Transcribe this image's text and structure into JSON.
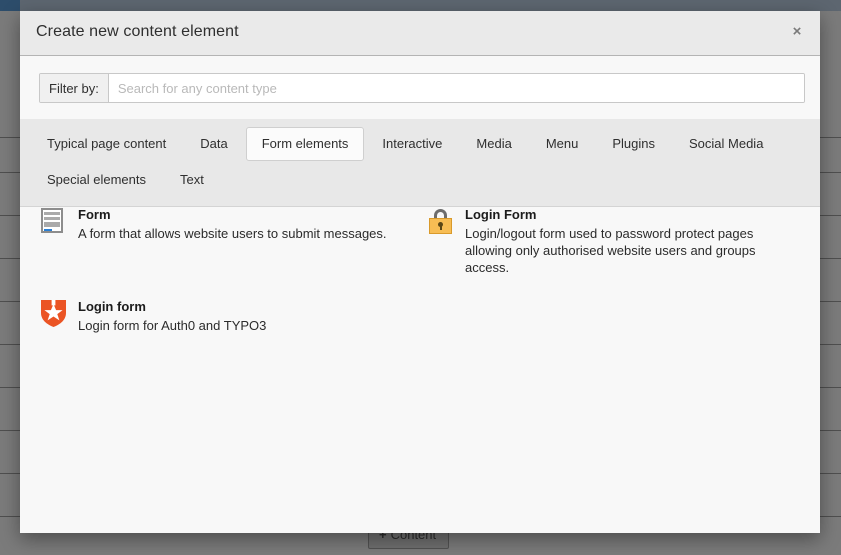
{
  "backdrop": {
    "content_button_label": "Content",
    "content_button_plus": "+",
    "row_positions": [
      137,
      172,
      215,
      258,
      301,
      344,
      387,
      430,
      473,
      516
    ]
  },
  "modal": {
    "title": "Create new content element",
    "close_label": "×",
    "close_icon": "close-icon"
  },
  "filter": {
    "label": "Filter by:",
    "placeholder": "Search for any content type",
    "value": ""
  },
  "tabs": {
    "rows": [
      [
        {
          "label": "Typical page content",
          "active": false
        },
        {
          "label": "Data",
          "active": false
        },
        {
          "label": "Form elements",
          "active": true
        },
        {
          "label": "Interactive",
          "active": false
        },
        {
          "label": "Media",
          "active": false
        },
        {
          "label": "Menu",
          "active": false
        },
        {
          "label": "Plugins",
          "active": false
        },
        {
          "label": "Social Media",
          "active": false
        }
      ],
      [
        {
          "label": "Special elements",
          "active": false
        },
        {
          "label": "Text",
          "active": false
        }
      ]
    ]
  },
  "items": [
    {
      "title": "Form",
      "description": "A form that allows website users to submit messages.",
      "icon": "form-icon",
      "accent_color": "#2a7fd4"
    },
    {
      "title": "Login Form",
      "description": "Login/logout form used to password protect pages allowing only authorised website users and groups access.",
      "icon": "lock-icon",
      "accent_color": "#f7bd54"
    },
    {
      "title": "Login form",
      "description": "Login form for Auth0 and TYPO3",
      "icon": "auth0-shield-icon",
      "accent_color": "#eb5424"
    }
  ]
}
